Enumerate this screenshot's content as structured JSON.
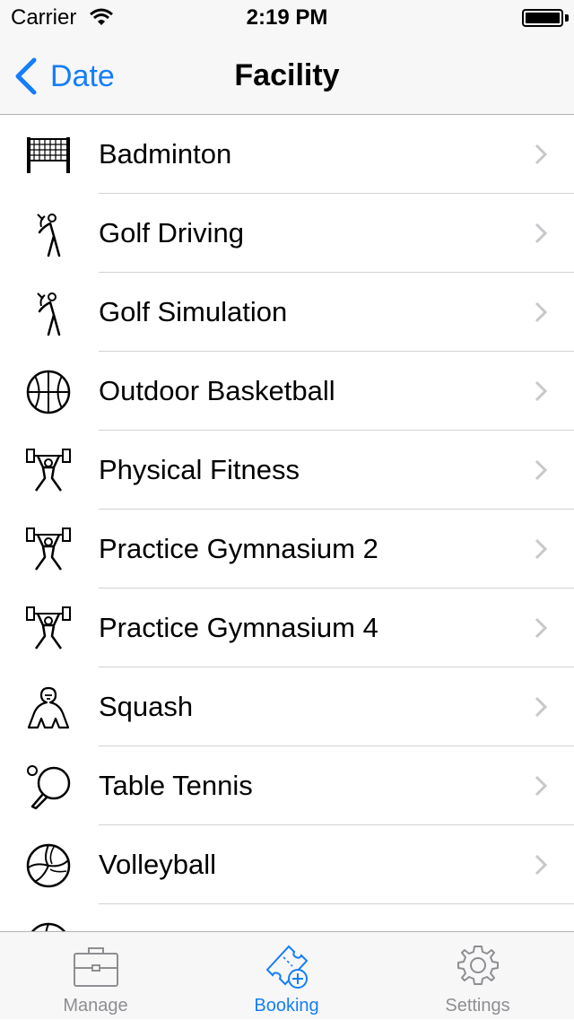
{
  "status_bar": {
    "carrier": "Carrier",
    "time": "2:19 PM"
  },
  "nav": {
    "back_label": "Date",
    "title": "Facility"
  },
  "facilities": [
    {
      "label": "Badminton",
      "icon": "badminton-net-icon"
    },
    {
      "label": "Golf Driving",
      "icon": "golfer-icon"
    },
    {
      "label": "Golf Simulation",
      "icon": "golfer-icon"
    },
    {
      "label": "Outdoor Basketball",
      "icon": "basketball-icon"
    },
    {
      "label": "Physical Fitness",
      "icon": "weightlifter-icon"
    },
    {
      "label": "Practice Gymnasium 2",
      "icon": "weightlifter-icon"
    },
    {
      "label": "Practice Gymnasium 4",
      "icon": "weightlifter-icon"
    },
    {
      "label": "Squash",
      "icon": "gorilla-icon"
    },
    {
      "label": "Table Tennis",
      "icon": "ping-pong-paddle-icon"
    },
    {
      "label": "Volleyball",
      "icon": "volleyball-icon"
    }
  ],
  "tab_bar": {
    "tabs": [
      {
        "label": "Manage",
        "icon": "briefcase-icon",
        "active": false
      },
      {
        "label": "Booking",
        "icon": "ticket-add-icon",
        "active": true
      },
      {
        "label": "Settings",
        "icon": "gear-icon",
        "active": false
      }
    ]
  },
  "colors": {
    "accent": "#147efb",
    "inactive": "#8e8e93",
    "bar_background": "#f7f7f7"
  }
}
